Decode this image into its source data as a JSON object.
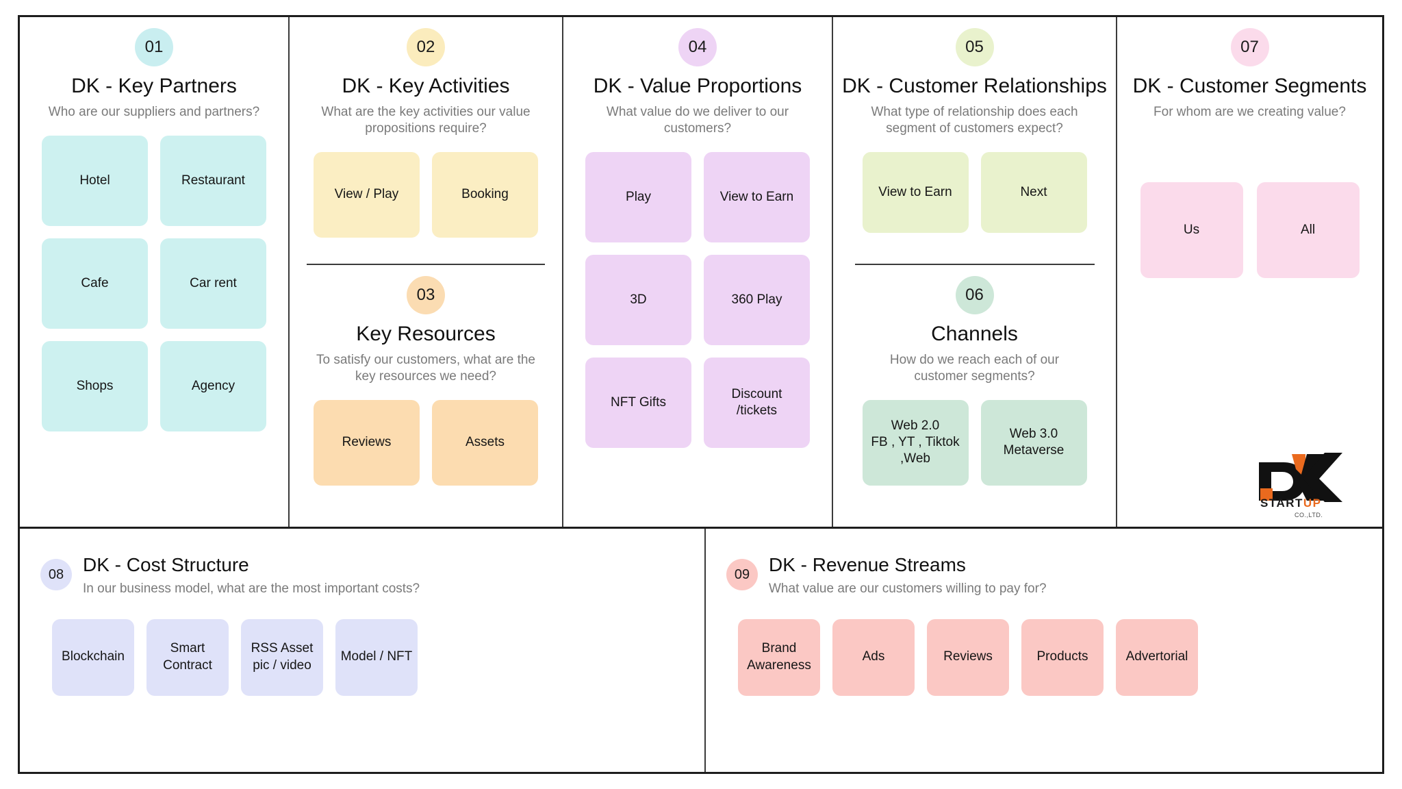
{
  "canvas": {
    "logo": {
      "mark": "DK",
      "word_start": "START",
      "word_up": "UP",
      "coltd": "CO.,LTD."
    },
    "colors": {
      "key_partners": "#cdf1f0",
      "key_activities": "#fbeec3",
      "key_resources": "#fcdcb0",
      "value_propositions": "#eed4f5",
      "customer_relationships": "#e9f2cd",
      "channels": "#cde7d8",
      "customer_segments": "#fbdbeb",
      "cost_structure": "#dfe2f9",
      "revenue_streams": "#fbc8c4",
      "badge_key_partners": "#c9eef0",
      "badge_key_activities": "#fbecbd",
      "badge_key_resources": "#fbdcb2",
      "badge_value_propositions": "#eed4f5",
      "badge_customer_relationships": "#e9f2cd",
      "badge_channels": "#cde7d8",
      "badge_customer_segments": "#fbdbeb",
      "badge_cost_structure": "#dfe2f9",
      "badge_revenue_streams": "#fbc8c4",
      "border": "#1d1d1d",
      "divider": "#3a3a3a",
      "title": "#111111",
      "subtitle": "#7a7a7a",
      "logo_orange": "#ea6a1e"
    },
    "blocks": {
      "key_partners": {
        "number": "01",
        "title": "DK - Key Partners",
        "subtitle": "Who are our suppliers and partners?",
        "cards": [
          "Hotel",
          "Restaurant",
          "Cafe",
          "Car rent",
          "Shops",
          "Agency"
        ]
      },
      "key_activities": {
        "number": "02",
        "title": "DK - Key Activities",
        "subtitle": "What are the key activities our value propositions require?",
        "cards": [
          "View / Play",
          "Booking"
        ]
      },
      "key_resources": {
        "number": "03",
        "title": "Key Resources",
        "subtitle": "To satisfy our customers, what are the key resources we need?",
        "cards": [
          "Reviews",
          "Assets"
        ]
      },
      "value_propositions": {
        "number": "04",
        "title": "DK - Value Proportions",
        "subtitle": "What value do we deliver to our customers?",
        "cards": [
          "Play",
          "View to Earn",
          "3D",
          "360 Play",
          "NFT Gifts",
          "Discount\n/tickets"
        ]
      },
      "customer_relationships": {
        "number": "05",
        "title": "DK - Customer Relationships",
        "subtitle": "What type of relationship does each segment of customers expect?",
        "cards": [
          "View to Earn",
          "Next"
        ]
      },
      "channels": {
        "number": "06",
        "title": "Channels",
        "subtitle": "How do we reach each of our customer segments?",
        "cards": [
          "Web 2.0\nFB , YT , Tiktok\n,Web",
          "Web 3.0\nMetaverse"
        ]
      },
      "customer_segments": {
        "number": "07",
        "title": "DK - Customer Segments",
        "subtitle": "For whom are we creating value?",
        "cards": [
          "Us",
          "All"
        ]
      },
      "cost_structure": {
        "number": "08",
        "title": "DK - Cost Structure",
        "subtitle": "In our business model, what are the most important costs?",
        "cards": [
          "Blockchain",
          "Smart Contract",
          "RSS Asset\npic / video",
          "Model / NFT"
        ]
      },
      "revenue_streams": {
        "number": "09",
        "title": "DK - Revenue Streams",
        "subtitle": "What value are our customers willing to pay for?",
        "cards": [
          "Brand\nAwareness",
          "Ads",
          "Reviews",
          "Products",
          "Advertorial"
        ]
      }
    }
  }
}
